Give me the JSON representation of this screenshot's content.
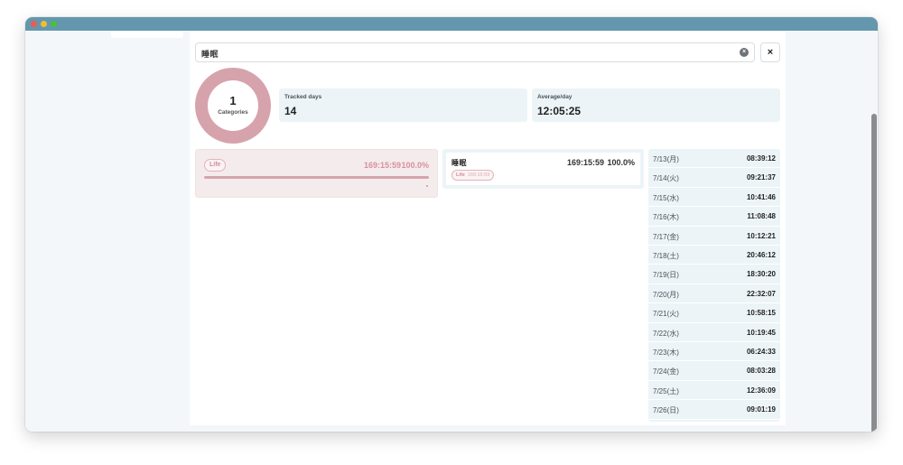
{
  "search": {
    "value": "睡眠"
  },
  "summary": {
    "category_count": "1",
    "category_label": "Categories",
    "tracked_days_label": "Tracked days",
    "tracked_days_value": "14",
    "average_label": "Average/day",
    "average_value": "12:05:25",
    "donut_color": "#d6a3ad"
  },
  "category": {
    "name": "Life",
    "total": "169:15:59",
    "percent": "100.0%",
    "color": "#d6a3ad"
  },
  "item": {
    "name": "睡眠",
    "total": "169:15:59",
    "percent": "100.0%",
    "tag_name": "Life",
    "tag_time": "169:15:59"
  },
  "days": [
    {
      "date": "7/13(月)",
      "time": "08:39:12"
    },
    {
      "date": "7/14(火)",
      "time": "09:21:37"
    },
    {
      "date": "7/15(水)",
      "time": "10:41:46"
    },
    {
      "date": "7/16(木)",
      "time": "11:08:48"
    },
    {
      "date": "7/17(金)",
      "time": "10:12:21"
    },
    {
      "date": "7/18(土)",
      "time": "20:46:12"
    },
    {
      "date": "7/19(日)",
      "time": "18:30:20"
    },
    {
      "date": "7/20(月)",
      "time": "22:32:07"
    },
    {
      "date": "7/21(火)",
      "time": "10:58:15"
    },
    {
      "date": "7/22(水)",
      "time": "10:19:45"
    },
    {
      "date": "7/23(木)",
      "time": "06:24:33"
    },
    {
      "date": "7/24(金)",
      "time": "08:03:28"
    },
    {
      "date": "7/25(土)",
      "time": "12:36:09"
    },
    {
      "date": "7/26(日)",
      "time": "09:01:19"
    }
  ]
}
